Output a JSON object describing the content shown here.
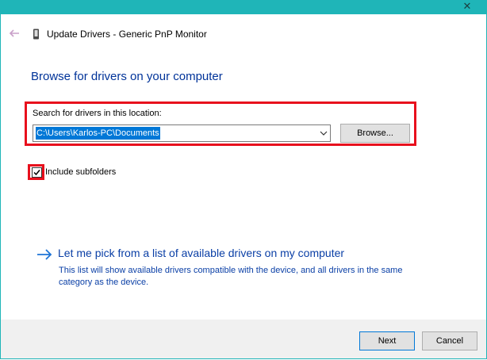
{
  "window": {
    "title": "Update Drivers - Generic PnP Monitor",
    "close_glyph": "✕",
    "titlebar_color": "#1fb5b8"
  },
  "heading": "Browse for drivers on your computer",
  "search": {
    "label": "Search for drivers in this location:",
    "path_value": "C:\\Users\\Karlos-PC\\Documents",
    "browse_label": "Browse..."
  },
  "include_subfolders": {
    "label": "Include subfolders",
    "checked": true
  },
  "pick_option": {
    "title": "Let me pick from a list of available drivers on my computer",
    "description": "This list will show available drivers compatible with the device, and all drivers in the same category as the device."
  },
  "buttons": {
    "next": "Next",
    "cancel": "Cancel"
  },
  "icons": {
    "back": "back-arrow-icon",
    "device": "monitor-device-icon",
    "dropdown": "chevron-down-icon",
    "checkmark": "checkmark-icon",
    "link_arrow": "arrow-right-icon"
  },
  "colors": {
    "highlight_red": "#e8101d",
    "heading_blue": "#003399",
    "link_blue": "#0a3fa6",
    "selection_blue": "#0078d7"
  }
}
